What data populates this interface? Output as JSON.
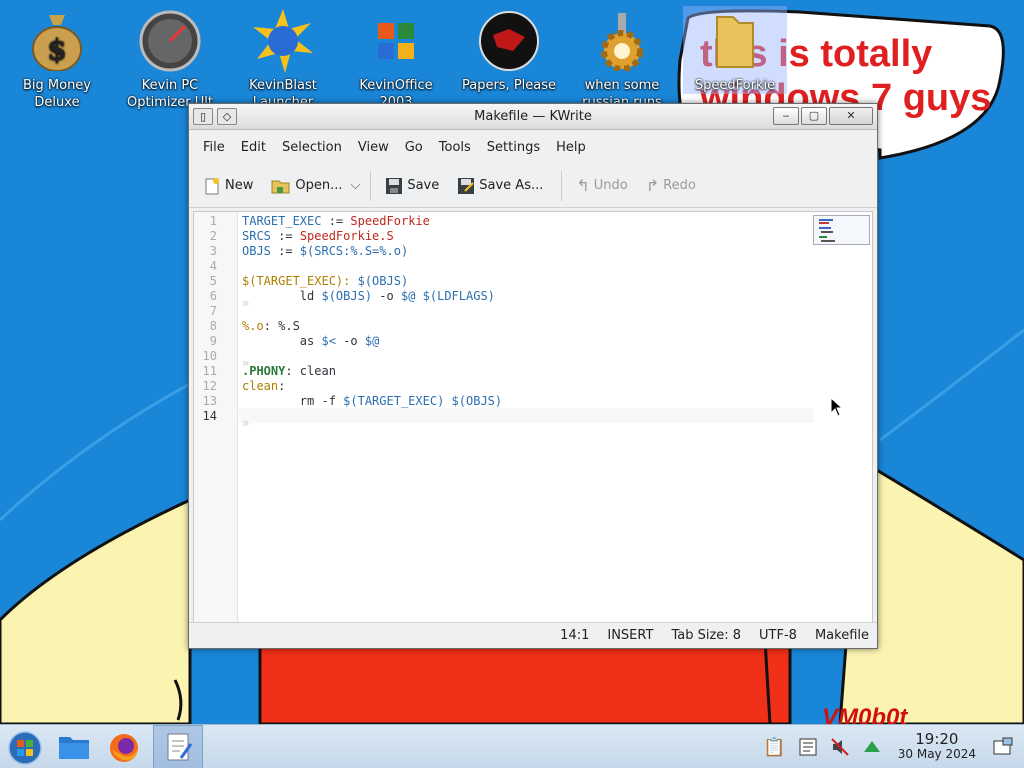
{
  "desktop": {
    "icons": [
      {
        "label": "Big Money Deluxe",
        "icon": "money-bag-icon"
      },
      {
        "label": "Kevin PC Optimizer Ult",
        "icon": "speedometer-icon"
      },
      {
        "label": "KevinBlast Launcher",
        "icon": "globe-burst-icon"
      },
      {
        "label": "KevinOffice 2003",
        "icon": "office-logo-icon"
      },
      {
        "label": "Papers, Please",
        "icon": "red-emblem-icon"
      },
      {
        "label": "when some russian runs a...",
        "icon": "gear-icon"
      },
      {
        "label": "SpeedForkie",
        "icon": "folder-icon"
      }
    ],
    "speech_bubble": "this is totally windows 7 guys",
    "scribble": "VM0b0t"
  },
  "window": {
    "title": "Makefile — KWrite",
    "menu": [
      "File",
      "Edit",
      "Selection",
      "View",
      "Go",
      "Tools",
      "Settings",
      "Help"
    ],
    "toolbar": {
      "new": "New",
      "open": "Open...",
      "save": "Save",
      "save_as": "Save As...",
      "undo": "Undo",
      "redo": "Redo"
    },
    "line_numbers": [
      "1",
      "2",
      "3",
      "4",
      "5",
      "6",
      "7",
      "8",
      "9",
      "10",
      "11",
      "12",
      "13",
      "14"
    ],
    "code_lines": [
      "TARGET_EXEC := SpeedForkie",
      "SRCS := SpeedForkie.S",
      "OBJS := $(SRCS:%.S=%.o)",
      "",
      "$(TARGET_EXEC): $(OBJS)",
      "        ld $(OBJS) -o $@ $(LDFLAGS)",
      "",
      "%.o: %.S",
      "        as $< -o $@",
      "",
      ".PHONY: clean",
      "clean:",
      "        rm -f $(TARGET_EXEC) $(OBJS)",
      ""
    ],
    "status": {
      "position": "14:1",
      "mode": "INSERT",
      "tab_size": "Tab Size: 8",
      "encoding": "UTF-8",
      "syntax": "Makefile"
    }
  },
  "taskbar": {
    "time": "19:20",
    "date": "30 May 2024"
  }
}
